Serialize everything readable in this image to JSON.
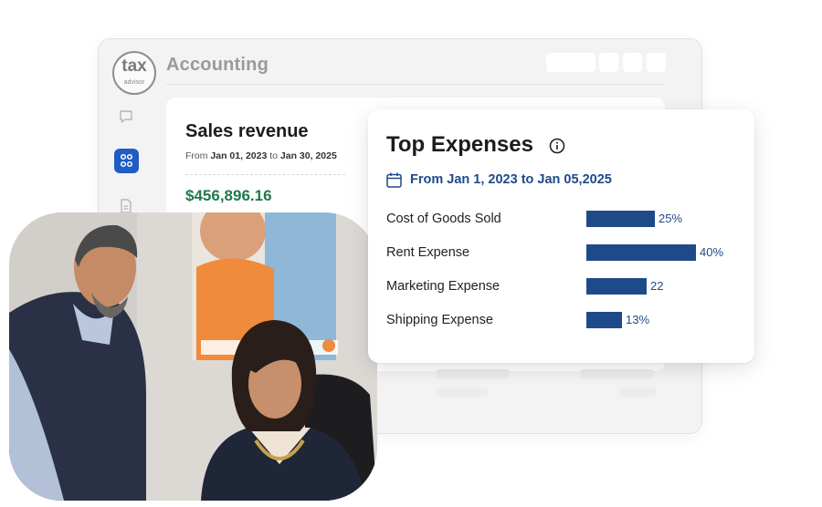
{
  "app": {
    "logo_main": "tax",
    "logo_sub": "advisor",
    "title": "Accounting"
  },
  "sidebar": {
    "icons": [
      "chat-icon",
      "grid-icon",
      "document-icon"
    ],
    "active_color": "#1f5cc4"
  },
  "sales_card": {
    "title": "Sales revenue",
    "range_prefix": "From",
    "range_start": "Jan 01, 2023",
    "range_mid": "to",
    "range_end": "Jan 30, 2025",
    "value": "$456,896.16",
    "value_color": "#1e7a4a"
  },
  "expenses_card": {
    "title": "Top Expenses",
    "range": "From Jan 1, 2023 to Jan 05,2025",
    "accent_color": "#1f4a8a",
    "items": [
      {
        "label": "Cost of Goods Sold",
        "value_text": "25%",
        "level": 25
      },
      {
        "label": "Rent Expense",
        "value_text": "40%",
        "level": 40
      },
      {
        "label": "Marketing Expense",
        "value_text": "22",
        "level": 22
      },
      {
        "label": "Shipping Expense",
        "value_text": "13%",
        "level": 13
      }
    ]
  }
}
